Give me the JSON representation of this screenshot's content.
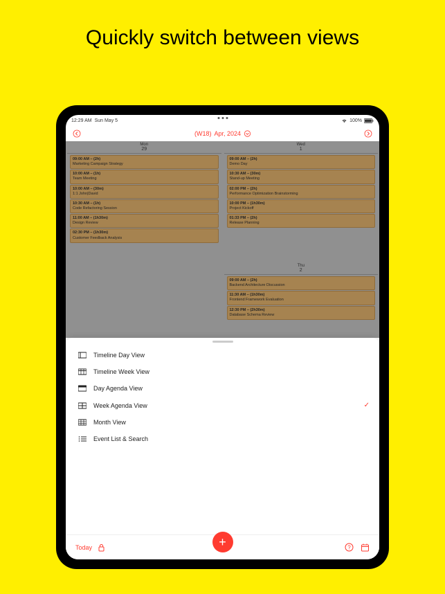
{
  "headline": "Quickly switch between views",
  "status": {
    "time": "12:29 AM",
    "date": "Sun May 5",
    "wifi": "wifi-icon",
    "battery": "100%"
  },
  "nav": {
    "week": "(W18)",
    "month": "Apr, 2024"
  },
  "days": [
    {
      "label": "Mon",
      "number": "29",
      "events": [
        {
          "time": "09:00 AM – (2h)",
          "title": "Marketing Campaign Strategy"
        },
        {
          "time": "10:00 AM – (1h)",
          "title": "Team Meeting"
        },
        {
          "time": "10:00 AM – (30m)",
          "title": "1:1 John|David"
        },
        {
          "time": "10:30 AM – (1h)",
          "title": "Code Refactoring Session"
        },
        {
          "time": "11:00 AM – (1h30m)",
          "title": "Design Review"
        },
        {
          "time": "02:30 PM – (1h30m)",
          "title": "Customer Feedback Analysis"
        }
      ]
    },
    {
      "label": "Wed",
      "number": "1",
      "events": [
        {
          "time": "09:00 AM – (2h)",
          "title": "Demo Day"
        },
        {
          "time": "10:30 AM – (30m)",
          "title": "Stand-up Meeting"
        },
        {
          "time": "02:00 PM – (2h)",
          "title": "Performance Optimization Brainstorming"
        },
        {
          "time": "10:00 PM – (1h30m)",
          "title": "Project Kickoff"
        },
        {
          "time": "01:33 PM – (2h)",
          "title": "Release Planning"
        }
      ]
    },
    {
      "label": "Thu",
      "number": "2",
      "events": [
        {
          "time": "09:00 AM – (2h)",
          "title": "Backend Architecture Discussion"
        },
        {
          "time": "11:30 AM – (1h30m)",
          "title": "Frontend Framework Evaluation"
        },
        {
          "time": "12:30 PM – (2h30m)",
          "title": "Database Schema Review"
        }
      ]
    }
  ],
  "menu": [
    {
      "icon": "timeline-day-icon",
      "label": "Timeline Day View",
      "selected": false
    },
    {
      "icon": "timeline-week-icon",
      "label": "Timeline Week View",
      "selected": false
    },
    {
      "icon": "day-agenda-icon",
      "label": "Day Agenda View",
      "selected": false
    },
    {
      "icon": "week-agenda-icon",
      "label": "Week Agenda View",
      "selected": true
    },
    {
      "icon": "month-view-icon",
      "label": "Month View",
      "selected": false
    },
    {
      "icon": "event-list-icon",
      "label": "Event List & Search",
      "selected": false
    }
  ],
  "bottom": {
    "today": "Today"
  },
  "colors": {
    "accent": "#ff3b30",
    "event_bg": "#c49a5f",
    "page_bg": "#ffef00"
  }
}
